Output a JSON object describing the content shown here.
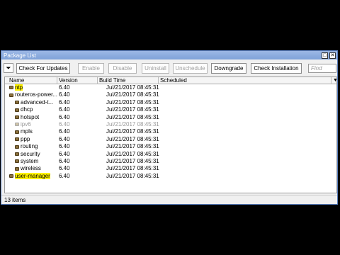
{
  "window": {
    "title": "Package List"
  },
  "window_buttons": {
    "maximize": "□",
    "close": "✕"
  },
  "toolbar": {
    "filter_icon": "funnel-icon",
    "buttons": [
      {
        "label": "Check For Updates",
        "enabled": true
      },
      {
        "label": "Enable",
        "enabled": false
      },
      {
        "label": "Disable",
        "enabled": false
      },
      {
        "label": "Uninstall",
        "enabled": false
      },
      {
        "label": "Unschedule",
        "enabled": false
      },
      {
        "label": "Downgrade",
        "enabled": true
      },
      {
        "label": "Check Installation",
        "enabled": true
      }
    ],
    "find_placeholder": "Find"
  },
  "table": {
    "columns": [
      "Name",
      "Version",
      "Build Time",
      "Scheduled"
    ],
    "sort_arrow": "▼",
    "rows": [
      {
        "name": "ntp",
        "version": "6.40",
        "build_time": "Jul/21/2017 08:45:31",
        "scheduled": "",
        "highlight": true,
        "disabled": false
      },
      {
        "name": "routeros-power...",
        "version": "6.40",
        "build_time": "Jul/21/2017 08:45:31",
        "scheduled": "",
        "highlight": false,
        "disabled": false
      },
      {
        "name": "advanced-t...",
        "version": "6.40",
        "build_time": "Jul/21/2017 08:45:31",
        "scheduled": "",
        "highlight": false,
        "disabled": false
      },
      {
        "name": "dhcp",
        "version": "6.40",
        "build_time": "Jul/21/2017 08:45:31",
        "scheduled": "",
        "highlight": false,
        "disabled": false
      },
      {
        "name": "hotspot",
        "version": "6.40",
        "build_time": "Jul/21/2017 08:45:31",
        "scheduled": "",
        "highlight": false,
        "disabled": false
      },
      {
        "name": "ipv6",
        "version": "6.40",
        "build_time": "Jul/21/2017 08:45:31",
        "scheduled": "",
        "highlight": false,
        "disabled": true
      },
      {
        "name": "mpls",
        "version": "6.40",
        "build_time": "Jul/21/2017 08:45:31",
        "scheduled": "",
        "highlight": false,
        "disabled": false
      },
      {
        "name": "ppp",
        "version": "6.40",
        "build_time": "Jul/21/2017 08:45:31",
        "scheduled": "",
        "highlight": false,
        "disabled": false
      },
      {
        "name": "routing",
        "version": "6.40",
        "build_time": "Jul/21/2017 08:45:31",
        "scheduled": "",
        "highlight": false,
        "disabled": false
      },
      {
        "name": "security",
        "version": "6.40",
        "build_time": "Jul/21/2017 08:45:31",
        "scheduled": "",
        "highlight": false,
        "disabled": false
      },
      {
        "name": "system",
        "version": "6.40",
        "build_time": "Jul/21/2017 08:45:31",
        "scheduled": "",
        "highlight": false,
        "disabled": false
      },
      {
        "name": "wireless",
        "version": "6.40",
        "build_time": "Jul/21/2017 08:45:31",
        "scheduled": "",
        "highlight": false,
        "disabled": false
      },
      {
        "name": "user-manager",
        "version": "6.40",
        "build_time": "Jul/21/2017 08:45:31",
        "scheduled": "",
        "highlight": true,
        "disabled": false
      }
    ]
  },
  "status": {
    "items_count": "13 items"
  },
  "colors": {
    "highlight": "#fff200",
    "titlebar": "#7fa2d8"
  }
}
